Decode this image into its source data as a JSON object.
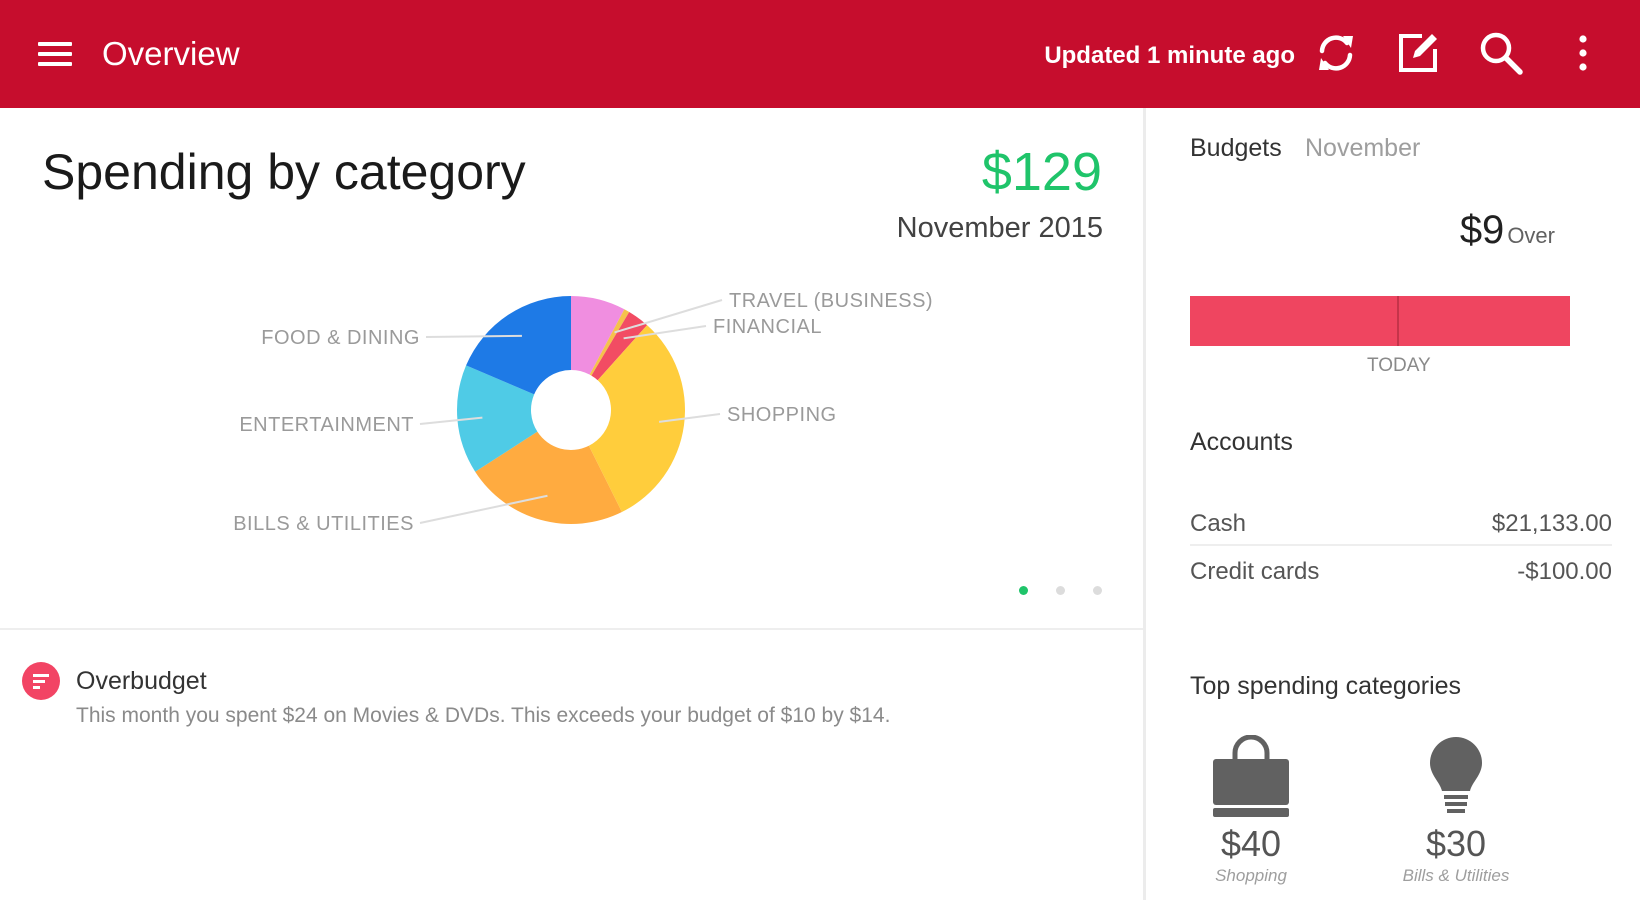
{
  "appbar": {
    "title": "Overview",
    "updated": "Updated 1 minute ago",
    "icons": [
      "menu-icon",
      "refresh-icon",
      "edit-icon",
      "search-icon",
      "more-vert-icon"
    ],
    "color": "#c60d2d"
  },
  "spending": {
    "title": "Spending by category",
    "total": "$129",
    "period": "November 2015",
    "accent": "#1fc46a",
    "pages": 3,
    "active_page": 1
  },
  "chart_data": {
    "type": "pie",
    "title": "",
    "categories": [
      "Pink (unlabeled)",
      "Travel (Business)",
      "Financial",
      "Shopping",
      "Bills & Utilities",
      "Entertainment",
      "Food & Dining"
    ],
    "labels": [
      "",
      "TRAVEL (BUSINESS)",
      "FINANCIAL",
      "SHOPPING",
      "BILLS & UTILITIES",
      "ENTERTAINMENT",
      "FOOD & DINING"
    ],
    "values": [
      10,
      1,
      4,
      40,
      30,
      20,
      24
    ],
    "colors": [
      "#f08ee0",
      "#f5c24b",
      "#f24c63",
      "#ffcd3c",
      "#ffab40",
      "#4fcbe6",
      "#1e7ae6"
    ],
    "donut": true,
    "legend": "callout labels"
  },
  "alert": {
    "title": "Overbudget",
    "body": "This month you spent $24 on Movies & DVDs. This exceeds your budget of $10 by $14.",
    "icon": "list-icon",
    "color": "#f24464"
  },
  "budgets": {
    "title": "Budgets",
    "month": "November",
    "amount": "$9",
    "status": "Over",
    "progress": 1.0,
    "today_fraction": 0.54,
    "today_label": "TODAY",
    "bar_color": "#ef4560"
  },
  "accounts": {
    "title": "Accounts",
    "rows": [
      {
        "name": "Cash",
        "balance": "$21,133.00"
      },
      {
        "name": "Credit cards",
        "balance": "-$100.00"
      }
    ]
  },
  "top_categories": {
    "title": "Top spending categories",
    "items": [
      {
        "amount": "$40",
        "name": "Shopping",
        "icon": "shopping-bag-icon"
      },
      {
        "amount": "$30",
        "name": "Bills & Utilities",
        "icon": "lightbulb-icon"
      }
    ]
  }
}
